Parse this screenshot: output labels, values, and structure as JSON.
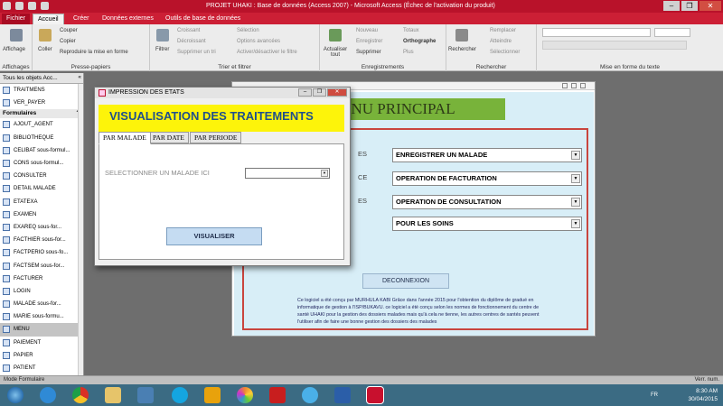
{
  "window": {
    "title": "PROJET UHAKI : Base de données (Access 2007) - Microsoft Access (Échec de l'activation du produit)"
  },
  "ribbon": {
    "tabs": [
      "Fichier",
      "Accueil",
      "Créer",
      "Données externes",
      "Outils de base de données"
    ],
    "groups": {
      "affichages": {
        "label": "Affichages",
        "button": "Affichage"
      },
      "presse_papiers": {
        "label": "Presse-papiers",
        "coller": "Coller",
        "couper": "Couper",
        "copier": "Copier",
        "reproduire": "Reproduire la mise en forme"
      },
      "trier": {
        "label": "Trier et filtrer",
        "filtrer": "Filtrer",
        "croissant": "Croissant",
        "decroissant": "Décroissant",
        "supprimer_tri": "Supprimer un tri",
        "selection": "Sélection",
        "options_avancees": "Options avancées",
        "activer_filtre": "Activer/désactiver le filtre"
      },
      "enregistrements": {
        "label": "Enregistrements",
        "actualiser": "Actualiser tout",
        "nouveau": "Nouveau",
        "enregistrer": "Enregistrer",
        "supprimer": "Supprimer",
        "totaux": "Totaux",
        "orthographe": "Orthographe",
        "plus": "Plus"
      },
      "rechercher": {
        "label": "Rechercher",
        "rechercher": "Rechercher",
        "remplacer": "Remplacer",
        "atteindre": "Atteindre",
        "selectionner": "Sélectionner"
      },
      "texte": {
        "label": "Mise en forme du texte"
      }
    }
  },
  "nav": {
    "header": "Tous les objets Acc...",
    "top_items": [
      "TRAITMENS",
      "VER_PAYER"
    ],
    "section": "Formulaires",
    "items": [
      "AJOUT_AGENT",
      "BIBLIOTHEQUE",
      "CELIBAT sous-formul...",
      "CONS sous-formul...",
      "CONSULTER",
      "DETAIL MALADE",
      "ETATEXA",
      "EXAMEN",
      "EXAREQ sous-for...",
      "FACTHIER sous-for...",
      "FACTPERIO sous-fo...",
      "FACTSEM sous-for...",
      "FACTURER",
      "LOGIN",
      "MALADE sous-for...",
      "MARIE sous-formu...",
      "MENU",
      "PAIEMENT",
      "PAPIER",
      "PATIENT"
    ],
    "selected_index": 16
  },
  "menu_form": {
    "title": "MENU PRINCIPAL",
    "labels": [
      "ES",
      "CE",
      "ES"
    ],
    "options": [
      "ENREGISTRER UN MALADE",
      "OPERATION DE FACTURATION",
      "OPERATION DE CONSULTATION",
      "POUR LES SOINS"
    ],
    "deconnexion": "DECONNEXION",
    "info": "Ce logiciel a été conçu par MURHULA KABI Grâce dans l'année 2015 pour l'obtention du diplôme de gradué en informatique de gestion à l'ISP/BUKAVU. ce logiciel a été conçu selon les normes de fonctionnement du centre de santé UHAKI pour la gestion des dossiers malades mais qu'à cela ne tienne, les autres centres de santés peuvent l'utiliser afin de faire une bonne gestion des dossiers des malades"
  },
  "dialog": {
    "title": "IMPRESSION DES ETATS",
    "heading": "VISUALISATION DES TRAITEMENTS",
    "tabs": [
      "PAR MALADE",
      "PAR DATE",
      "PAR PERIODE"
    ],
    "field_label": "SELECTIONNER UN MALADE ICI",
    "combo_value": "",
    "button": "VISUALISER"
  },
  "statusbar": {
    "left": "Mode Formulaire",
    "right": "Verr. num."
  },
  "taskbar": {
    "icons": [
      "start-orb",
      "ie",
      "chrome",
      "folder",
      "media",
      "skype",
      "winamp",
      "photos",
      "acrobat",
      "network",
      "word",
      "access"
    ],
    "lang": "FR",
    "time": "8:30 AM",
    "date": "30/04/2015"
  },
  "colors": {
    "access_red": "#b9122a",
    "yellow_heading": "#fdf40a",
    "menu_green": "#78b33a",
    "frame_red": "#c9453e"
  }
}
